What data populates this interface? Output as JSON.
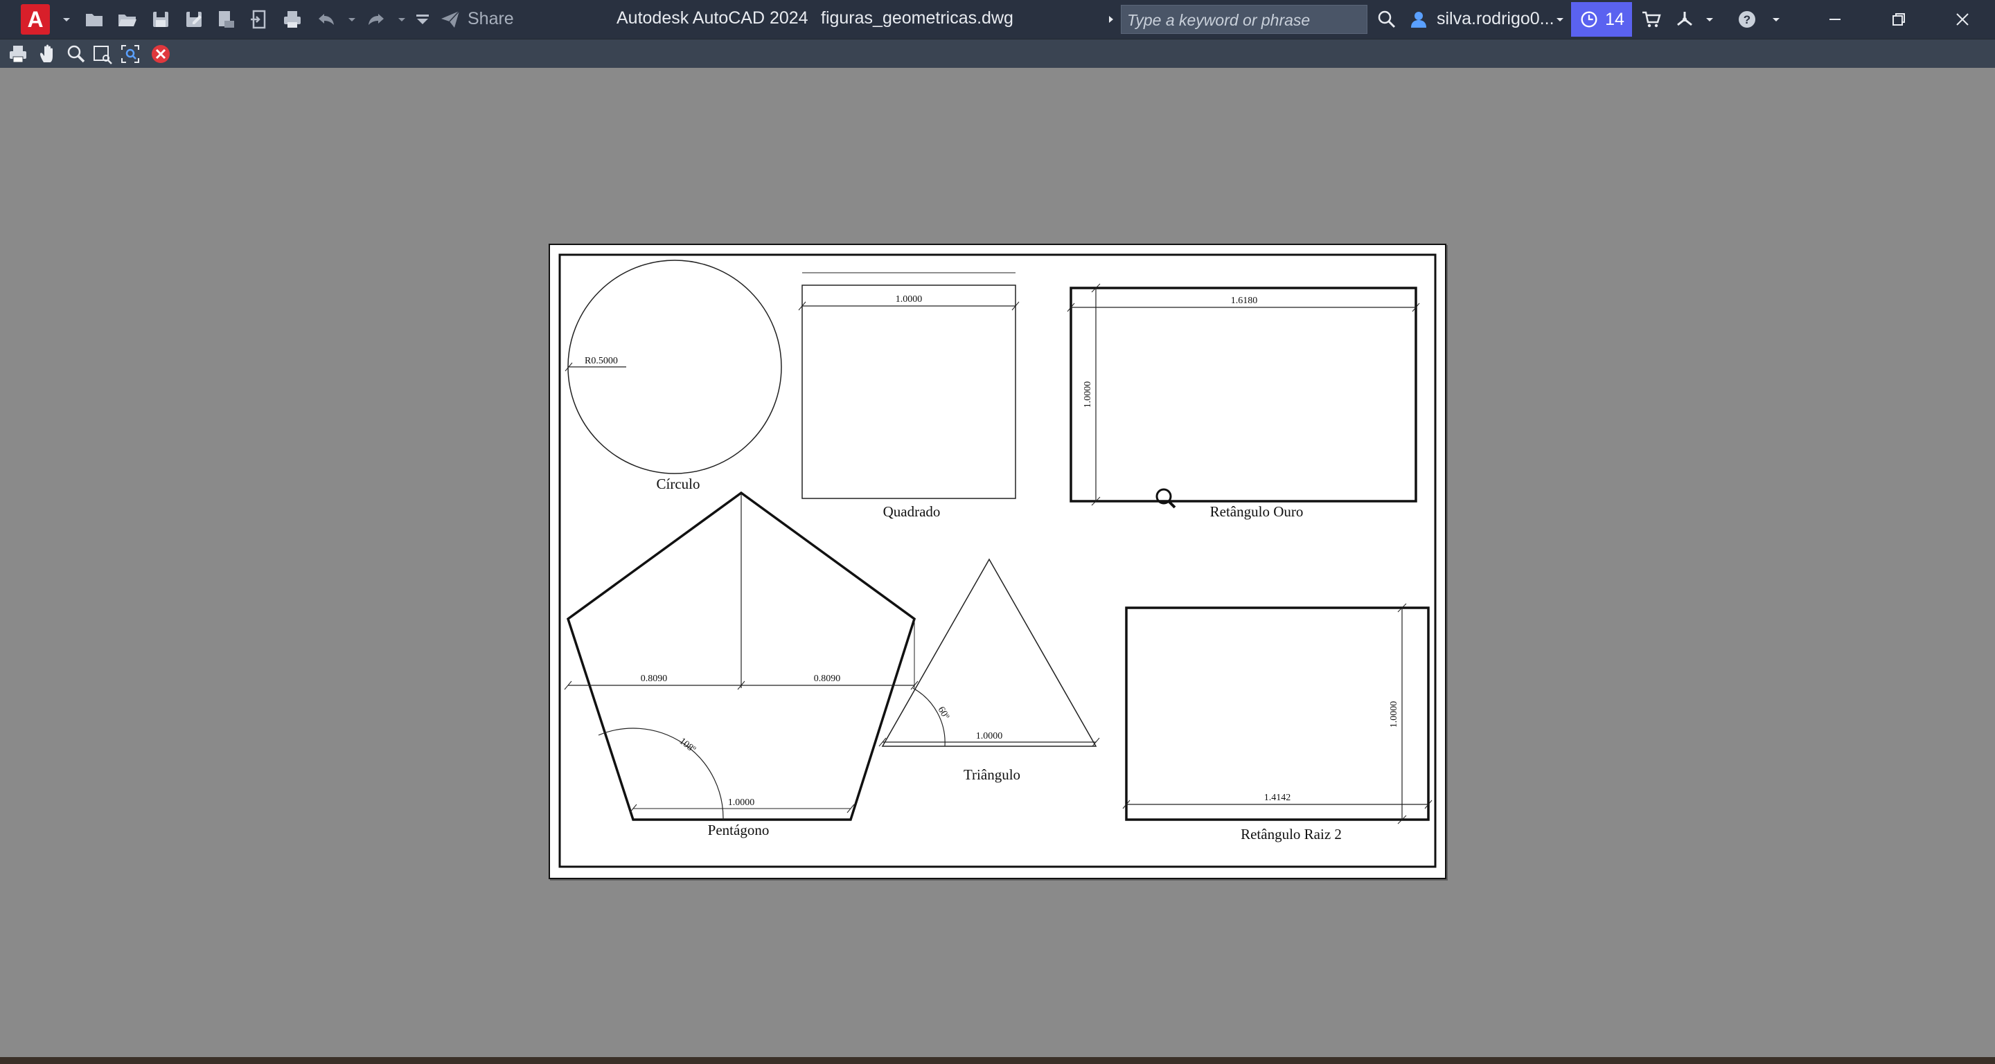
{
  "titlebar": {
    "app_logo_letter": "A",
    "share_label": "Share",
    "app_title": "Autodesk AutoCAD 2024",
    "file_name": "figuras_geometricas.dwg",
    "search_placeholder": "Type a keyword or phrase",
    "user_name": "silva.rodrigo0...",
    "notifications_count": "14"
  },
  "drawing": {
    "circle": {
      "label": "Círculo",
      "radius_dim": "R0.5000"
    },
    "square": {
      "label": "Quadrado",
      "width_dim": "1.0000"
    },
    "golden_rect": {
      "label": "Retângulo Ouro",
      "width_dim": "1.6180",
      "height_dim": "1.0000"
    },
    "pentagon": {
      "label": "Pentágono",
      "half_width_left": "0.8090",
      "half_width_right": "0.8090",
      "angle": "108º",
      "side_dim": "1.0000"
    },
    "triangle": {
      "label": "Triângulo",
      "angle": "60º",
      "side_dim": "1.0000"
    },
    "root2_rect": {
      "label": "Retângulo Raiz 2",
      "width_dim": "1.4142",
      "height_dim": "1.0000"
    }
  },
  "colors": {
    "titlebar": "#293140",
    "toolbar": "#3a4452",
    "canvas_bg": "#8a8a8a",
    "paper": "#ffffff",
    "badge": "#5a62f0",
    "logo": "#d81f2a",
    "close_icon": "#e0383d"
  }
}
